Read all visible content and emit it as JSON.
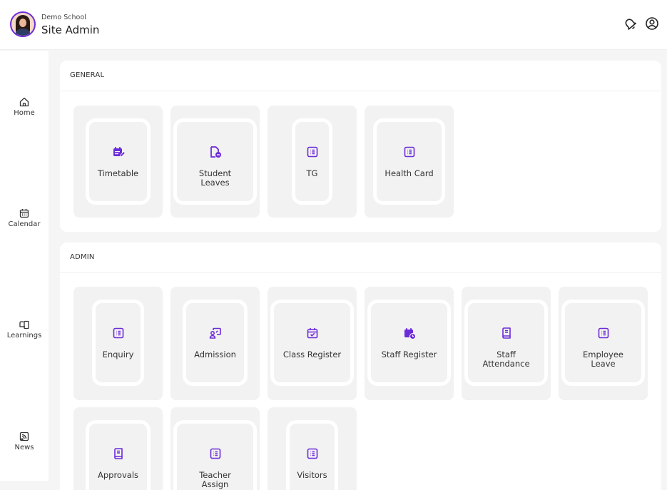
{
  "header": {
    "school_name": "Demo School",
    "role": "Site Admin",
    "icons": [
      "bell-icon",
      "user-icon"
    ]
  },
  "sidebar": {
    "items": [
      {
        "label": "Home",
        "icon": "home-icon"
      },
      {
        "label": "Calendar",
        "icon": "calendar-icon"
      },
      {
        "label": "Learnings",
        "icon": "learnings-icon"
      },
      {
        "label": "News",
        "icon": "news-icon"
      }
    ]
  },
  "sections": {
    "general": {
      "title": "GENERAL",
      "tiles": [
        {
          "label": "Timetable",
          "icon": "timetable-icon"
        },
        {
          "label": "Student\nLeaves",
          "icon": "document-minus-icon"
        },
        {
          "label": "TG",
          "icon": "list-icon"
        },
        {
          "label": "Health Card",
          "icon": "list-icon"
        }
      ]
    },
    "admin": {
      "title": "ADMIN",
      "tiles": [
        {
          "label": "Enquiry",
          "icon": "list-icon"
        },
        {
          "label": "Admission",
          "icon": "admission-icon"
        },
        {
          "label": "Class Register",
          "icon": "calendar-check-icon"
        },
        {
          "label": "Staff Register",
          "icon": "calendar-clock-icon"
        },
        {
          "label": "Staff\nAttendance",
          "icon": "book-icon"
        },
        {
          "label": "Employee\nLeave",
          "icon": "list-icon"
        },
        {
          "label": "Approvals",
          "icon": "book-icon"
        },
        {
          "label": "Teacher\nAssign",
          "icon": "list-icon"
        },
        {
          "label": "Visitors",
          "icon": "list-icon"
        }
      ]
    }
  },
  "colors": {
    "accent": "#6c2bd9",
    "tile_bg": "#f2f2f2",
    "page_bg": "#f5f5f5"
  }
}
